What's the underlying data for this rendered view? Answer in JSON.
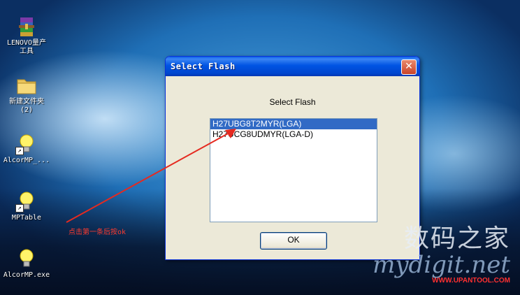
{
  "desktop": {
    "icons": [
      {
        "label_line1": "LENOVO量产",
        "label_line2": "工具",
        "icon": "winrar-archive-icon"
      },
      {
        "label_line1": "新建文件夹",
        "label_line2": "(2)",
        "icon": "folder-icon"
      },
      {
        "label_line1": "AlcorMP_...",
        "label_line2": "",
        "icon": "lightbulb-shortcut-icon"
      },
      {
        "label_line1": "MPTable",
        "label_line2": "",
        "icon": "lightbulb-shortcut-icon"
      },
      {
        "label_line1": "AlcorMP.exe",
        "label_line2": "",
        "icon": "lightbulb-icon"
      }
    ]
  },
  "dialog": {
    "title": "Select Flash",
    "close_glyph": "✕",
    "heading": "Select Flash",
    "items": [
      {
        "label": "H27UBG8T2MYR(LGA)",
        "selected": true
      },
      {
        "label": "H27UCG8UDMYR(LGA-D)",
        "selected": false
      }
    ],
    "ok_label": "OK"
  },
  "annotation": {
    "text": "点击第一条后按ok",
    "color": "#ff3b2f"
  },
  "watermark": {
    "cn": "数码之家",
    "en": "mydigit.net",
    "url": "WWW.UPANTOOL.COM"
  },
  "colors": {
    "titlebar": "#0054e3",
    "selection": "#316ac5",
    "dialog_bg": "#ece9d8"
  }
}
